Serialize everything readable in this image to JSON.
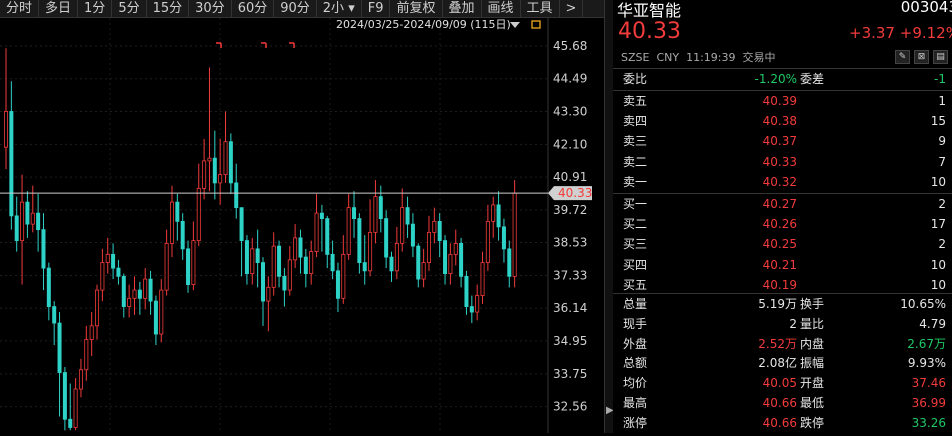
{
  "toolbar": [
    "分时",
    "多日",
    "1分",
    "5分",
    "15分",
    "30分",
    "60分",
    "90分",
    "2小",
    "F9",
    "前复权",
    "叠加",
    "画线",
    "工具",
    ">"
  ],
  "date_range": "2024/03/25-2024/09/09 (115日)",
  "chart_data": {
    "type": "candlestick",
    "yticks": [
      45.68,
      44.49,
      43.3,
      42.1,
      40.91,
      39.72,
      38.53,
      37.33,
      36.14,
      34.95,
      33.75,
      32.56
    ],
    "ylim": [
      31.6,
      46.7
    ],
    "current_price_label": "40.33",
    "current_price": 40.33,
    "candles": [
      [
        42,
        43.3,
        41.2,
        45.6
      ],
      [
        43.3,
        39.5,
        39,
        44.4
      ],
      [
        39.5,
        38.6,
        38.2,
        40.2
      ],
      [
        38.6,
        40,
        37,
        41
      ],
      [
        40,
        39.2,
        38.7,
        40.4
      ],
      [
        39.2,
        39.6,
        38.9,
        40.6
      ],
      [
        39.6,
        39,
        38.2,
        40.3
      ],
      [
        39,
        37.6,
        36.8,
        39.6
      ],
      [
        37.6,
        36.2,
        35.7,
        37.8
      ],
      [
        36.2,
        35.6,
        34.8,
        36.4
      ],
      [
        35.6,
        33.8,
        32.2,
        36
      ],
      [
        33.8,
        32.1,
        31.7,
        34
      ],
      [
        32.1,
        31.8,
        31.7,
        33.4
      ],
      [
        31.8,
        33.2,
        31.7,
        33.6
      ],
      [
        33.2,
        33.9,
        32.9,
        34.3
      ],
      [
        33.9,
        35,
        33.5,
        35.5
      ],
      [
        35,
        35.5,
        34.4,
        36
      ],
      [
        35.5,
        36.8,
        35,
        37
      ],
      [
        36.8,
        37.8,
        36.4,
        38.3
      ],
      [
        37.8,
        38.1,
        37.4,
        38.7
      ],
      [
        38.1,
        37.6,
        37.2,
        38.5
      ],
      [
        37.6,
        37.3,
        37,
        37.9
      ],
      [
        37.3,
        36.2,
        35.8,
        37.4
      ],
      [
        36.2,
        36.5,
        35.8,
        37
      ],
      [
        36.5,
        36.8,
        35.9,
        37.3
      ],
      [
        36.8,
        36.5,
        35.9,
        37.1
      ],
      [
        36.5,
        37.2,
        36.1,
        37.6
      ],
      [
        37.2,
        36.4,
        35.9,
        37.5
      ],
      [
        36.4,
        35.2,
        34.8,
        36.6
      ],
      [
        35.2,
        36.8,
        34.9,
        37.2
      ],
      [
        36.8,
        38.5,
        36.6,
        39
      ],
      [
        38.5,
        40,
        38,
        40.6
      ],
      [
        40,
        39.3,
        38.6,
        40.3
      ],
      [
        39.3,
        38.3,
        37.9,
        39.6
      ],
      [
        38.3,
        37,
        36.7,
        38.6
      ],
      [
        37,
        38.6,
        36.8,
        39.3
      ],
      [
        38.6,
        40.5,
        38.4,
        41.4
      ],
      [
        40.5,
        41.5,
        40.1,
        42.3
      ],
      [
        41.5,
        41.6,
        40.4,
        44.9
      ],
      [
        41.6,
        40.7,
        40.1,
        42.6
      ],
      [
        40.7,
        41,
        39.9,
        42.3
      ],
      [
        41,
        42.2,
        40.7,
        43.3
      ],
      [
        42.2,
        40.7,
        40.3,
        42.5
      ],
      [
        40.7,
        39.8,
        39.4,
        41.4
      ],
      [
        39.8,
        38.6,
        37.3,
        39.8
      ],
      [
        38.6,
        37.4,
        37,
        38.8
      ],
      [
        37.4,
        38.3,
        37,
        38.7
      ],
      [
        38.3,
        37.8,
        36.9,
        39
      ],
      [
        37.8,
        36.4,
        35.5,
        38
      ],
      [
        36.4,
        36.9,
        35.3,
        37.3
      ],
      [
        36.9,
        38.4,
        36.6,
        38.9
      ],
      [
        38.4,
        37.3,
        36.9,
        38.6
      ],
      [
        37.3,
        36.8,
        36.2,
        37.6
      ],
      [
        36.8,
        37.9,
        36.6,
        38.4
      ],
      [
        37.9,
        38.7,
        37.6,
        39.2
      ],
      [
        38.7,
        38,
        37.4,
        39
      ],
      [
        38,
        37.4,
        36.9,
        38.3
      ],
      [
        37.4,
        38.2,
        37,
        38.6
      ],
      [
        38.2,
        39.6,
        38,
        40.3
      ],
      [
        39.6,
        39.4,
        38.2,
        39.9
      ],
      [
        39.4,
        38.1,
        37.6,
        39.5
      ],
      [
        38.1,
        37.5,
        37.2,
        38.6
      ],
      [
        37.5,
        36.5,
        36,
        37.8
      ],
      [
        36.5,
        38.1,
        36.3,
        38.8
      ],
      [
        38.1,
        39.8,
        37.9,
        40.3
      ],
      [
        39.8,
        39.4,
        38.7,
        40.4
      ],
      [
        39.4,
        37.8,
        37.4,
        39.6
      ],
      [
        37.8,
        37.5,
        37,
        38.8
      ],
      [
        37.5,
        38.9,
        37.3,
        40.1
      ],
      [
        38.9,
        40.2,
        38.5,
        40.8
      ],
      [
        40.2,
        39.4,
        38.9,
        40.6
      ],
      [
        39.4,
        38,
        37.6,
        39.7
      ],
      [
        38,
        37.5,
        37.1,
        38.2
      ],
      [
        37.5,
        38.5,
        37.2,
        39.1
      ],
      [
        38.5,
        39.8,
        38.2,
        40.5
      ],
      [
        39.8,
        39.2,
        38.7,
        40.2
      ],
      [
        39.2,
        38.4,
        38,
        39.6
      ],
      [
        38.4,
        37.2,
        36.9,
        38.5
      ],
      [
        37.2,
        37.8,
        36.9,
        38.3
      ],
      [
        37.8,
        38.9,
        37.5,
        39.5
      ],
      [
        38.9,
        39.3,
        38.5,
        39.8
      ],
      [
        39.3,
        38.6,
        38,
        39.6
      ],
      [
        38.6,
        37.4,
        37,
        38.8
      ],
      [
        37.4,
        38.1,
        37,
        38.5
      ],
      [
        38.1,
        38.5,
        37.7,
        39
      ],
      [
        38.5,
        37.3,
        36.9,
        38.7
      ],
      [
        37.3,
        36.2,
        35.9,
        37.5
      ],
      [
        36.2,
        36,
        35.6,
        36.6
      ],
      [
        36,
        36.6,
        35.7,
        37
      ],
      [
        36.6,
        37.8,
        36.3,
        38.2
      ],
      [
        37.8,
        39.3,
        37.5,
        39.9
      ],
      [
        39.3,
        39.9,
        38.7,
        40.2
      ],
      [
        39.9,
        39.1,
        38.6,
        40.4
      ],
      [
        39.1,
        38.3,
        37.8,
        39.4
      ],
      [
        38.3,
        37.3,
        36.9,
        38.6
      ],
      [
        37.3,
        40.33,
        36.9,
        40.8
      ]
    ]
  },
  "markers_top": 3,
  "quote": {
    "name": "华亚智能",
    "code": "003043",
    "price": "40.33",
    "change": "+3.37",
    "pct": "+9.12%",
    "exchange": "SZSE",
    "currency": "CNY",
    "time": "11:19:39",
    "status": "交易中",
    "weibi_label": "委比",
    "weibi": "-1.20%",
    "weicha_label": "委差",
    "weicha": "-1",
    "asks": [
      {
        "label": "卖五",
        "price": "40.39",
        "vol": "1"
      },
      {
        "label": "卖四",
        "price": "40.38",
        "vol": "15"
      },
      {
        "label": "卖三",
        "price": "40.37",
        "vol": "9"
      },
      {
        "label": "卖二",
        "price": "40.33",
        "vol": "7"
      },
      {
        "label": "卖一",
        "price": "40.32",
        "vol": "10"
      }
    ],
    "bids": [
      {
        "label": "买一",
        "price": "40.27",
        "vol": "2"
      },
      {
        "label": "买二",
        "price": "40.26",
        "vol": "17"
      },
      {
        "label": "买三",
        "price": "40.25",
        "vol": "2"
      },
      {
        "label": "买四",
        "price": "40.21",
        "vol": "10"
      },
      {
        "label": "买五",
        "price": "40.19",
        "vol": "10"
      }
    ],
    "stats": [
      {
        "l1": "总量",
        "v1": "5.19万",
        "c1": "white",
        "l2": "换手",
        "v2": "10.65%",
        "c2": "white"
      },
      {
        "l1": "现手",
        "v1": "2",
        "c1": "white",
        "l2": "量比",
        "v2": "4.79",
        "c2": "white"
      },
      {
        "l1": "外盘",
        "v1": "2.52万",
        "c1": "red",
        "l2": "内盘",
        "v2": "2.67万",
        "c2": "green"
      },
      {
        "l1": "总额",
        "v1": "2.08亿",
        "c1": "white",
        "l2": "振幅",
        "v2": "9.93%",
        "c2": "white"
      },
      {
        "l1": "均价",
        "v1": "40.05",
        "c1": "red",
        "l2": "开盘",
        "v2": "37.46",
        "c2": "red"
      },
      {
        "l1": "最高",
        "v1": "40.66",
        "c1": "red",
        "l2": "最低",
        "v2": "36.99",
        "c2": "red"
      },
      {
        "l1": "涨停",
        "v1": "40.66",
        "c1": "red",
        "l2": "跌停",
        "v2": "33.26",
        "c2": "green"
      }
    ]
  },
  "colors": {
    "up": "#f23b3b",
    "down": "#2ed3c8",
    "bg": "#000000"
  }
}
